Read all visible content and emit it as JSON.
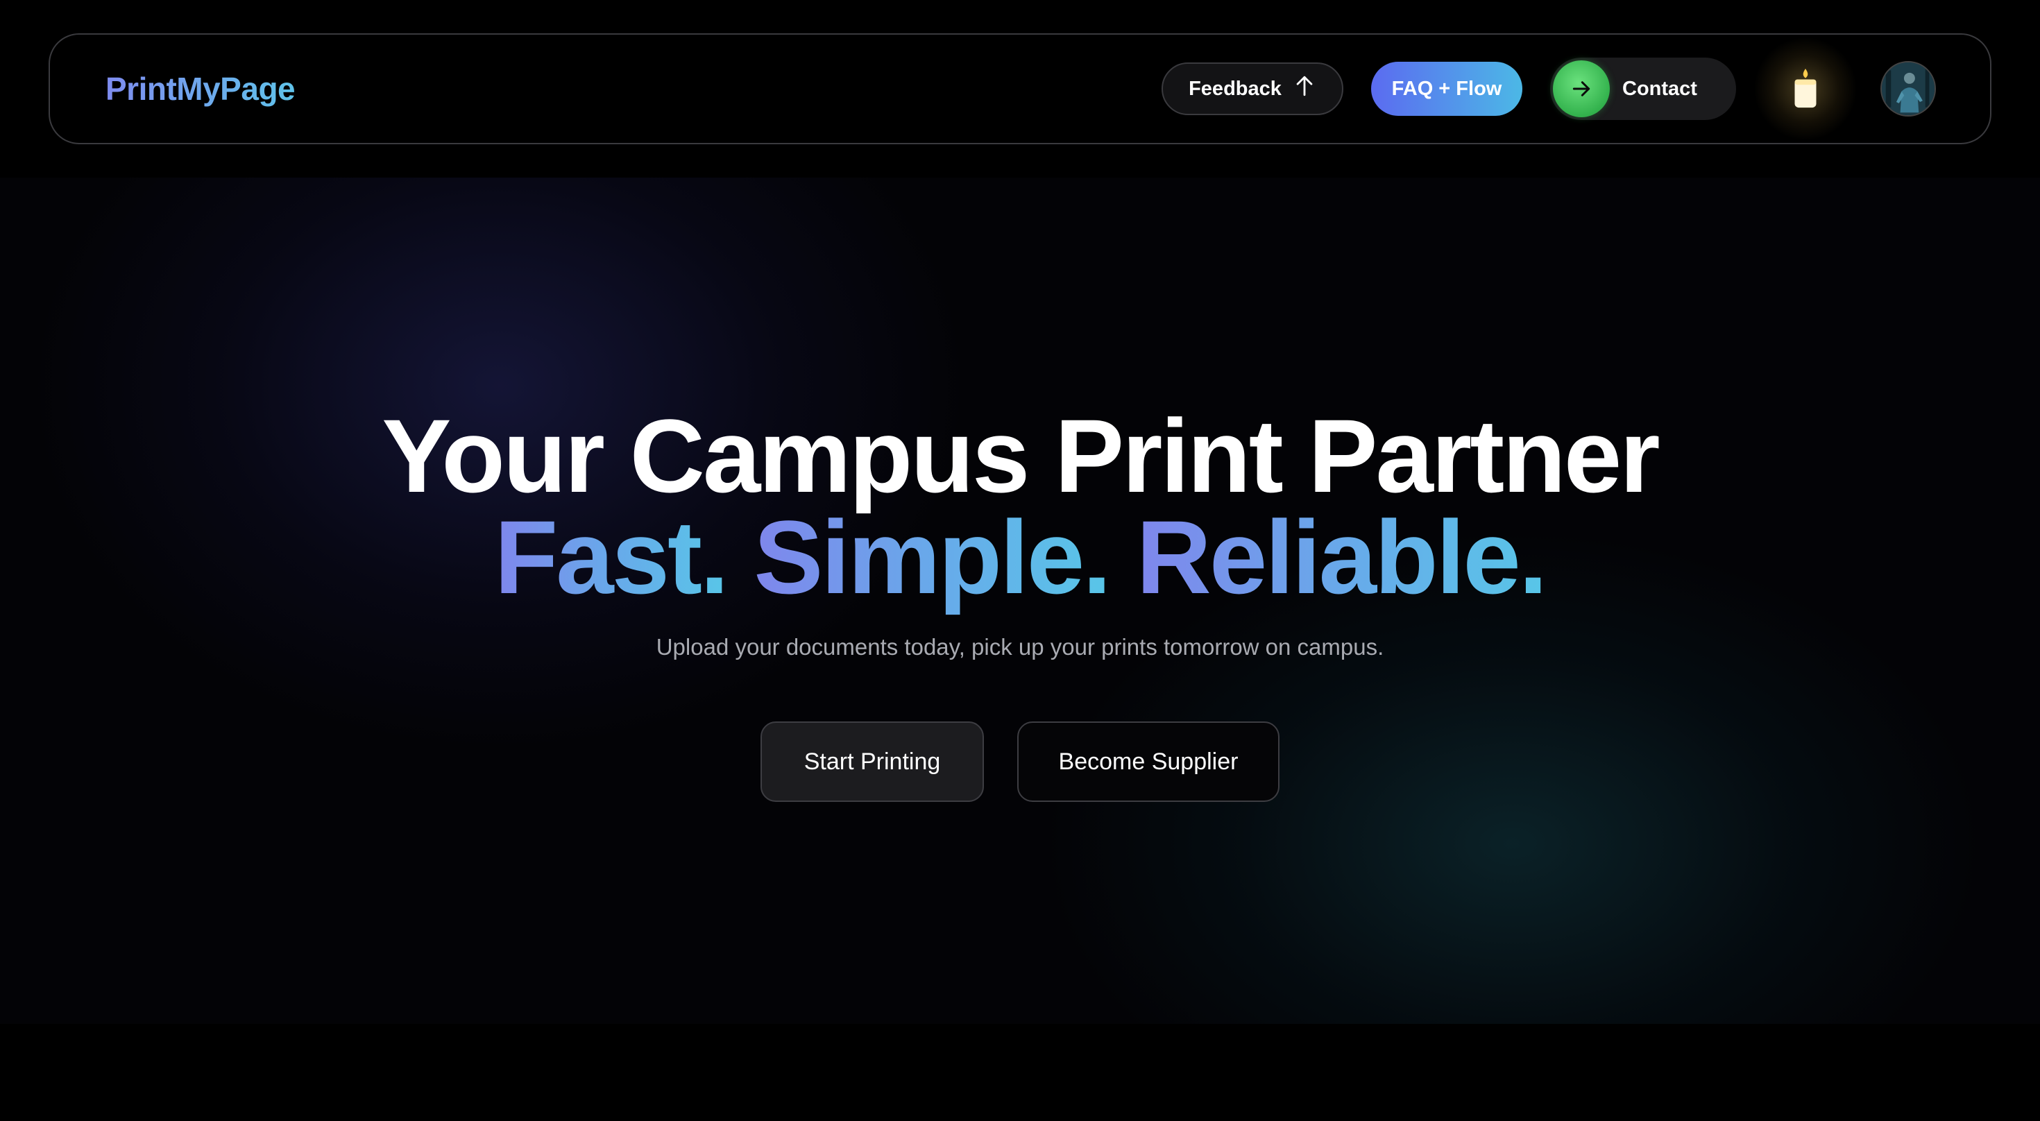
{
  "brand": {
    "name": "PrintMyPage"
  },
  "nav": {
    "feedback_label": "Feedback",
    "faq_label": "FAQ + Flow",
    "contact_label": "Contact",
    "theme_icon": "candle-icon",
    "avatar_icon": "user-avatar"
  },
  "hero": {
    "headline_line1": "Your Campus Print Partner",
    "headline_words": [
      "Fast.",
      "Simple.",
      "Reliable."
    ],
    "tagline": "Upload your documents today, pick up your prints tomorrow on campus.",
    "primary_cta": "Start Printing",
    "secondary_cta": "Become Supplier"
  },
  "colors": {
    "background": "#000000",
    "brand_gradient_start": "#7f8cf0",
    "brand_gradient_end": "#5fc3ea",
    "faq_gradient_start": "#5b6bf0",
    "faq_gradient_end": "#4cb8e6",
    "contact_accent": "#33b24d",
    "tagline_text": "#a9abb2"
  }
}
